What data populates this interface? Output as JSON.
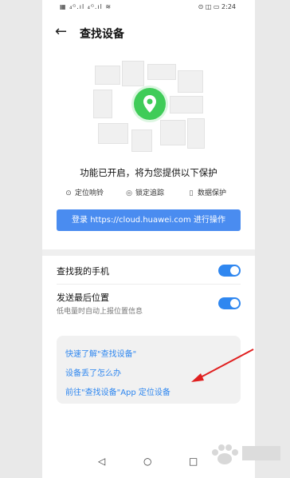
{
  "status_bar": {
    "left_icons": "▦ ₄ᴳ.ıl ₄ᴳ.ıl ≋",
    "right_icons": "⊙ ◫ ▭",
    "time": "2:24"
  },
  "header": {
    "back_icon": "arrow-left-icon",
    "title": "查找设备"
  },
  "hero": {
    "icon": "location-pin-icon",
    "accent_color": "#3fcc58"
  },
  "headline": "功能已开启，将为您提供以下保护",
  "features": [
    {
      "icon": "location-icon",
      "label": "定位响铃"
    },
    {
      "icon": "lock-icon",
      "label": "锁定追踪"
    },
    {
      "icon": "phone-icon",
      "label": "数据保护"
    }
  ],
  "login_button": {
    "label": "登录 https://cloud.huawei.com 进行操作",
    "color": "#4a8cf0"
  },
  "settings": {
    "find_phone": {
      "label": "查找我的手机",
      "enabled": true
    },
    "send_last_location": {
      "label": "发送最后位置",
      "sublabel": "低电量时自动上报位置信息",
      "enabled": true
    }
  },
  "links": [
    "快速了解\"查找设备\"",
    "设备丢了怎么办",
    "前往\"查找设备\"App 定位设备"
  ],
  "link_color": "#2f87f0",
  "nav": {
    "back": "◁",
    "home": "○",
    "recent": "□"
  },
  "annotation": {
    "arrow_color": "#e02020"
  }
}
